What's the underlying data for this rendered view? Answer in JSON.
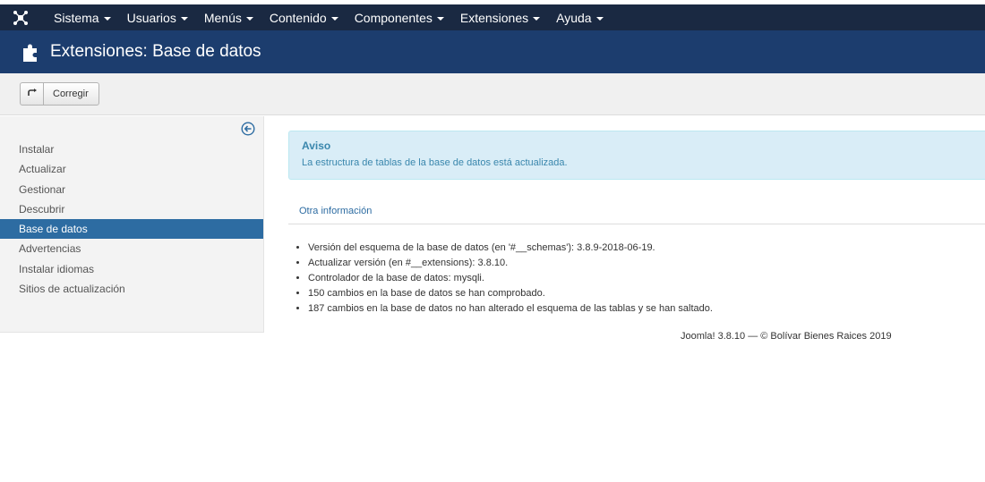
{
  "topbar": {
    "logo_icon": "joomla-logo-icon",
    "menu": [
      {
        "label": "Sistema"
      },
      {
        "label": "Usuarios"
      },
      {
        "label": "Menús"
      },
      {
        "label": "Contenido"
      },
      {
        "label": "Componentes"
      },
      {
        "label": "Extensiones"
      },
      {
        "label": "Ayuda"
      }
    ]
  },
  "header": {
    "icon": "puzzle-icon",
    "title": "Extensiones: Base de datos"
  },
  "toolbar": {
    "corregir_label": "Corregir",
    "corregir_icon": "refresh-icon"
  },
  "sidebar": {
    "toggle_icon": "collapse-arrow-icon",
    "items": [
      {
        "label": "Instalar"
      },
      {
        "label": "Actualizar"
      },
      {
        "label": "Gestionar"
      },
      {
        "label": "Descubrir"
      },
      {
        "label": "Base de datos",
        "active": true
      },
      {
        "label": "Advertencias"
      },
      {
        "label": "Instalar idiomas"
      },
      {
        "label": "Sitios de actualización"
      }
    ]
  },
  "alert": {
    "title": "Aviso",
    "message": "La estructura de tablas de la base de datos está actualizada."
  },
  "tabs": {
    "other_info": "Otra información"
  },
  "info": [
    "Versión del esquema de la base de datos (en '#__schemas'): 3.8.9-2018-06-19.",
    "Actualizar versión (en #__extensions): 3.8.10.",
    "Controlador de la base de datos: mysqli.",
    "150 cambios en la base de datos se han comprobado.",
    "187 cambios en la base de datos no han alterado el esquema de las tablas y se han saltado."
  ],
  "footer": "Joomla! 3.8.10 — © Bolívar Bienes Raices 2019",
  "colors": {
    "topbar": "#1a2942",
    "header": "#1c3d6e",
    "active_item": "#2d6ca2",
    "alert_bg": "#d9edf7",
    "alert_text": "#3a87ad"
  }
}
